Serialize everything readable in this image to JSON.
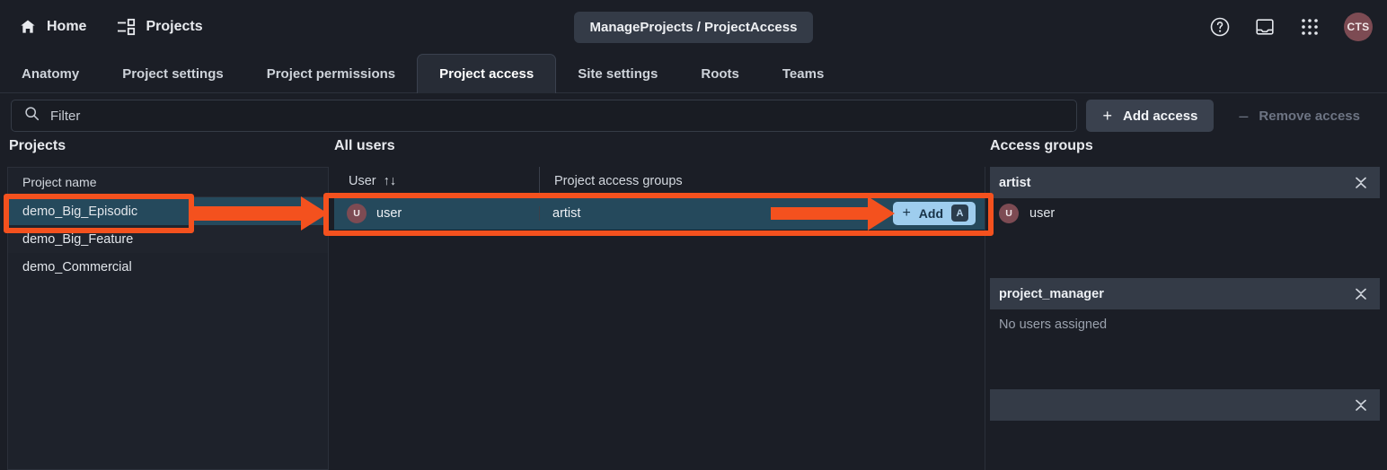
{
  "topbar": {
    "home_label": "Home",
    "projects_label": "Projects",
    "breadcrumb": "ManageProjects / ProjectAccess",
    "help_icon": "question-circle-icon",
    "inbox_icon": "inbox-icon",
    "apps_icon": "apps-grid-icon",
    "avatar_initials": "CTS"
  },
  "tabs": [
    {
      "label": "Anatomy",
      "active": false
    },
    {
      "label": "Project settings",
      "active": false
    },
    {
      "label": "Project permissions",
      "active": false
    },
    {
      "label": "Project access",
      "active": true
    },
    {
      "label": "Site settings",
      "active": false
    },
    {
      "label": "Roots",
      "active": false
    },
    {
      "label": "Teams",
      "active": false
    }
  ],
  "toolbar": {
    "filter_placeholder": "Filter",
    "filter_value": "",
    "add_access_label": "Add access",
    "add_access_sign": "+",
    "remove_access_label": "Remove access",
    "remove_access_sign": "–"
  },
  "projects_panel": {
    "title": "Projects",
    "column_header": "Project name",
    "rows": [
      {
        "name": "demo_Big_Episodic",
        "selected": true
      },
      {
        "name": "demo_Big_Feature",
        "selected": false
      },
      {
        "name": "demo_Commercial",
        "selected": false
      }
    ]
  },
  "users_panel": {
    "title": "All users",
    "columns": [
      {
        "label": "User",
        "sort_icon": "↑↓"
      },
      {
        "label": "Project access groups"
      }
    ],
    "rows": [
      {
        "avatar": "U",
        "user": "user",
        "groups": "artist",
        "selected": true,
        "add_label": "Add",
        "add_sign": "+",
        "add_shortcut": "A"
      }
    ]
  },
  "groups_panel": {
    "title": "Access groups",
    "groups": [
      {
        "name": "artist",
        "collapse_icon": "collapse-chevrons-icon",
        "members": [
          {
            "avatar": "U",
            "name": "user"
          }
        ],
        "empty_text": ""
      },
      {
        "name": "project_manager",
        "collapse_icon": "collapse-chevrons-icon",
        "members": [],
        "empty_text": "No users assigned"
      },
      {
        "name": "",
        "collapse_icon": "collapse-chevrons-icon",
        "members": [],
        "empty_text": ""
      }
    ]
  },
  "annotations": {
    "highlight_color": "#f4511e",
    "boxes": [
      {
        "target": "demo_Big_Episodic project row"
      },
      {
        "target": "user row with Add button"
      }
    ],
    "arrows": [
      {
        "from": "project row",
        "to": "user row"
      },
      {
        "from": "user row",
        "to": "Add button"
      }
    ]
  }
}
